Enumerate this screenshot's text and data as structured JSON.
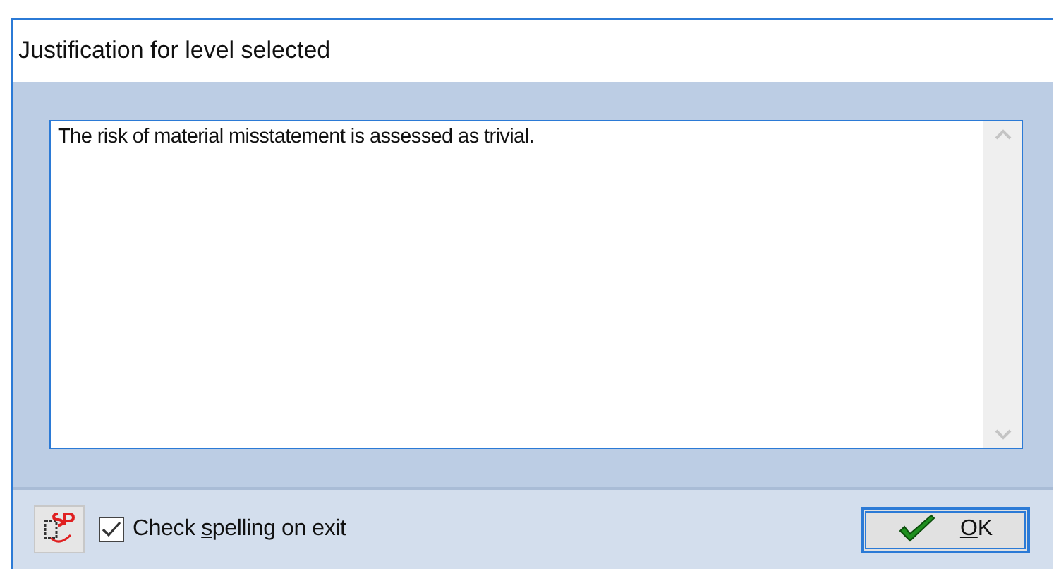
{
  "window": {
    "title": "Justification for level selected"
  },
  "text_area": {
    "value": "The risk of material misstatement is assessed as trivial.\n"
  },
  "spell_check": {
    "label_before": "Check ",
    "access_key": "s",
    "label_after": "pelling on exit",
    "checked": true
  },
  "ok_button": {
    "access_key": "O",
    "label_after": "K"
  }
}
